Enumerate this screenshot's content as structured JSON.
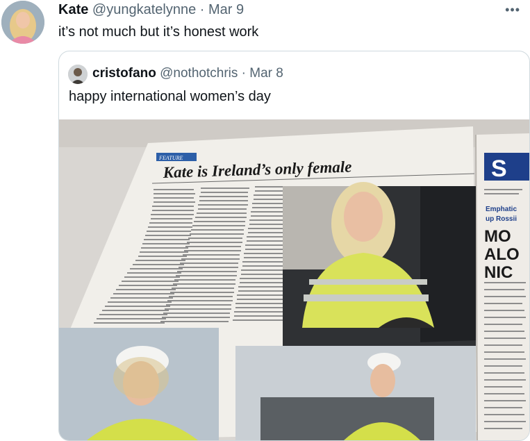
{
  "tweet": {
    "author_name": "Kate",
    "author_handle": "@yungkatelynne",
    "separator": "·",
    "date": "Mar 9",
    "text": "it’s not much but it’s honest work",
    "more_icon": "more-dots-icon"
  },
  "quoted": {
    "author_name": "cristofano",
    "author_handle": "@nothotchris",
    "separator": "·",
    "date": "Mar 8",
    "text": "happy international women’s day"
  },
  "newspaper": {
    "section_label": "FEATURE",
    "headline": "Kate is Ireland’s only female",
    "side_page_letters": "S",
    "side_page_lines": [
      "Emphatic",
      "up Rossii",
      "MO",
      "ALO",
      "NIC"
    ]
  }
}
